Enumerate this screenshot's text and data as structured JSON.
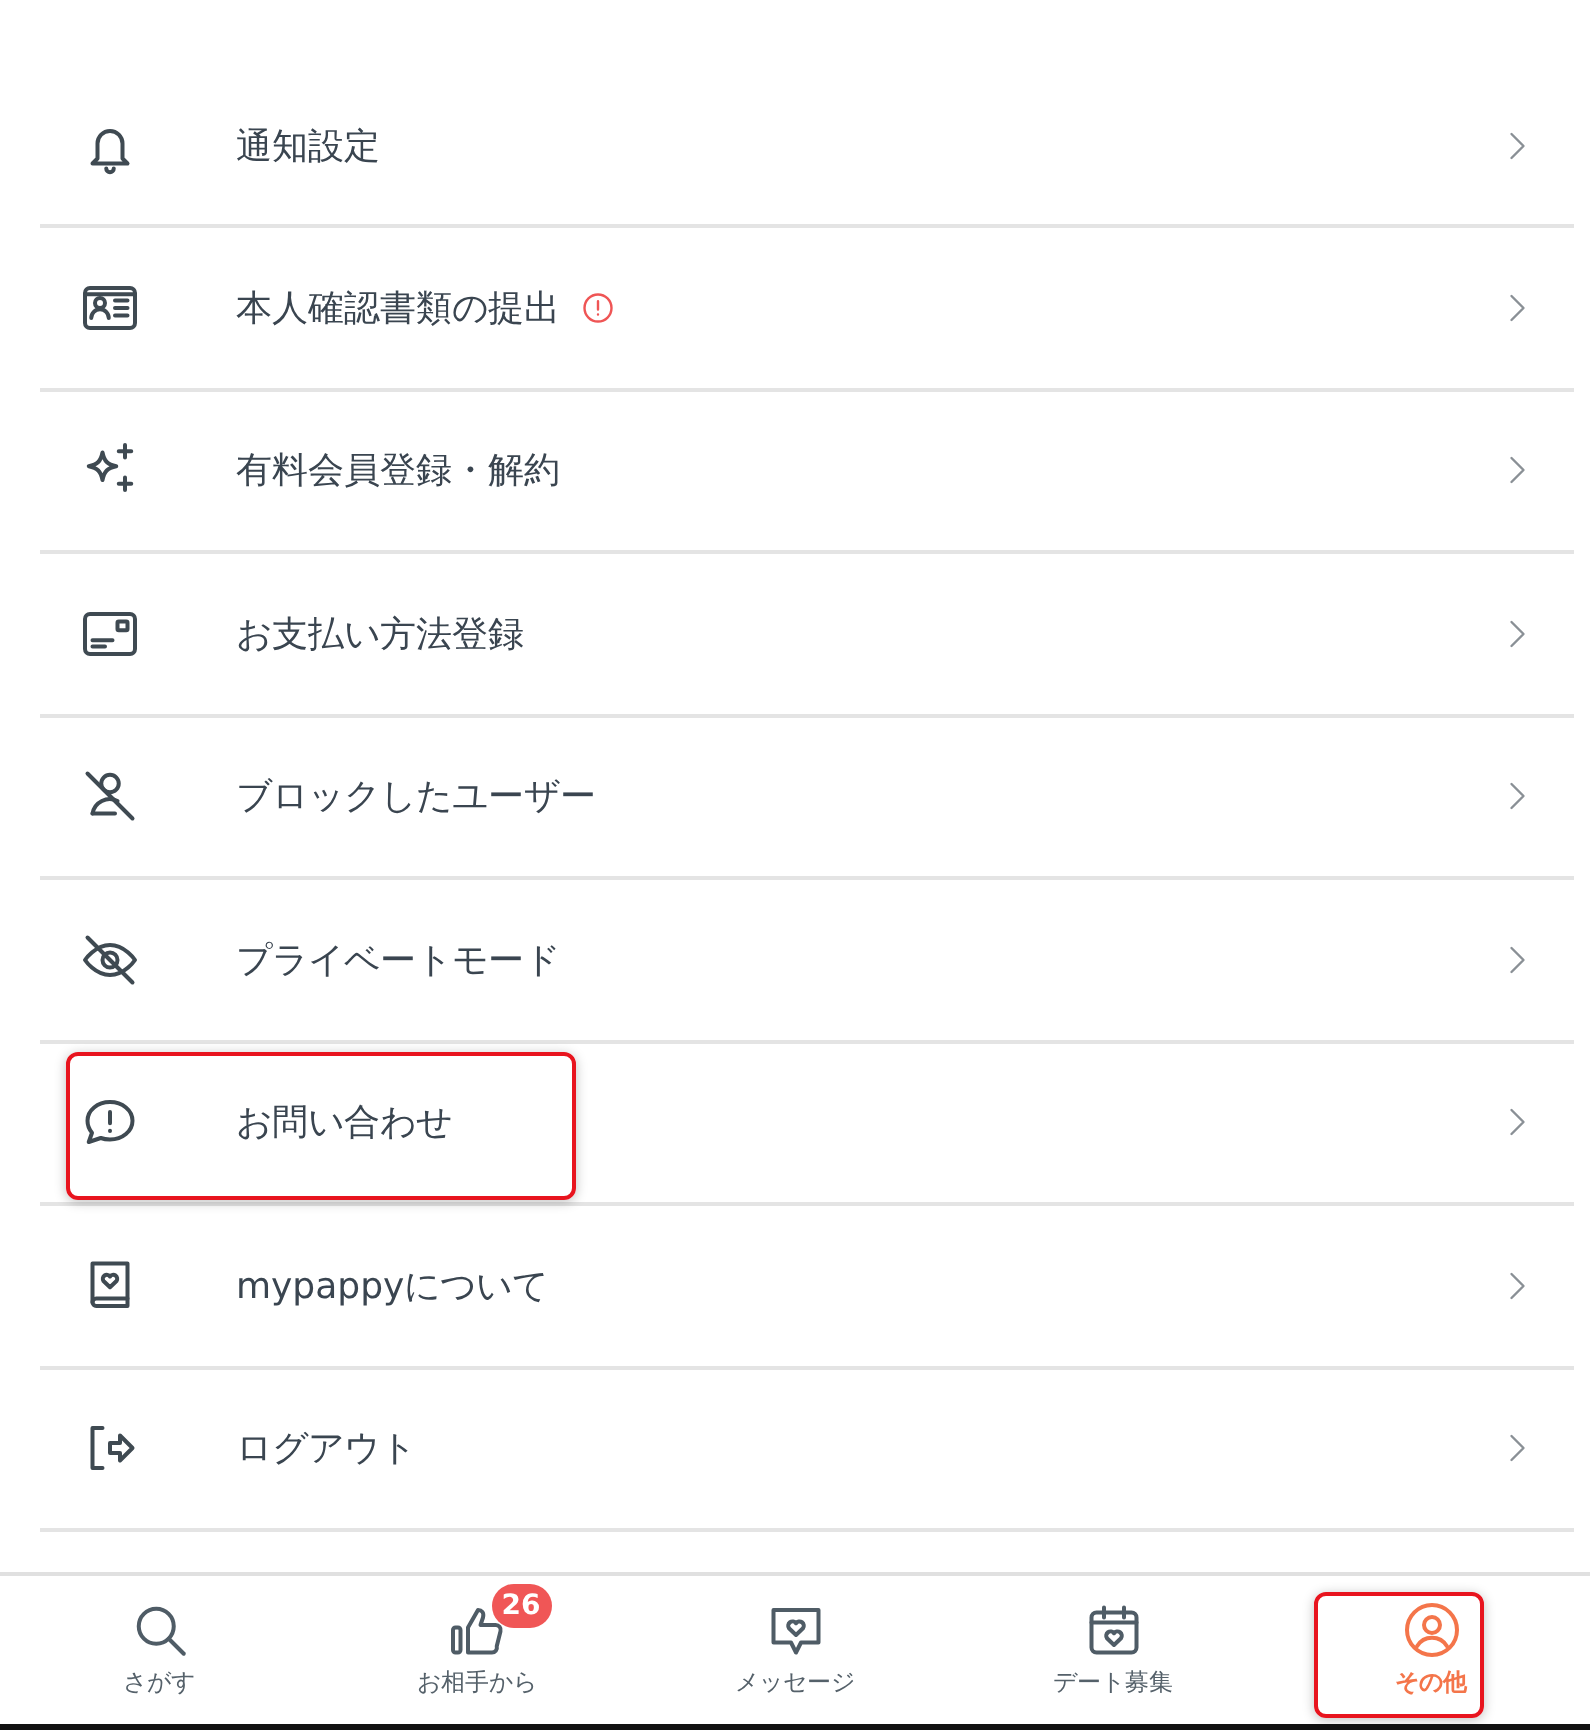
{
  "menu": {
    "items": [
      {
        "label": "通知設定"
      },
      {
        "label": "本人確認書類の提出",
        "alert": true
      },
      {
        "label": "有料会員登録・解約"
      },
      {
        "label": "お支払い方法登録"
      },
      {
        "label": "ブロックしたユーザー"
      },
      {
        "label": "プライベートモード"
      },
      {
        "label": "お問い合わせ",
        "highlighted": true
      },
      {
        "label": "mypappyについて"
      },
      {
        "label": "ログアウト"
      }
    ]
  },
  "tab_bar": {
    "tabs": [
      {
        "label": "さがす",
        "selected": false
      },
      {
        "label": "お相手から",
        "selected": false,
        "badge": "26"
      },
      {
        "label": "メッセージ",
        "selected": false
      },
      {
        "label": "デート募集",
        "selected": false
      },
      {
        "label": "その他",
        "selected": true,
        "highlighted": true
      }
    ]
  }
}
